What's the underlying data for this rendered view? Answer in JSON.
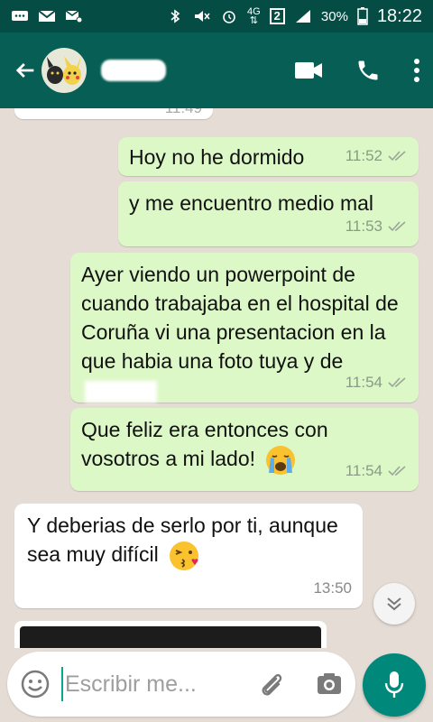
{
  "status_bar": {
    "network": "4G",
    "sim": "2",
    "battery": "30%",
    "time": "18:22"
  },
  "conversation": {
    "partial_top_time": "11:49",
    "messages": [
      {
        "direction": "out",
        "text": "Hoy no he dormido",
        "time": "11:52"
      },
      {
        "direction": "out",
        "text": "y me encuentro medio mal",
        "time": "11:53"
      },
      {
        "direction": "out",
        "text": "Ayer viendo un powerpoint de cuando trabajaba en el hospital de Coruña vi una presentacion en la que habia una foto tuya y de",
        "time": "11:54"
      },
      {
        "direction": "out",
        "text": "Que feliz era entonces con vosotros a mi lado!",
        "time": "11:54",
        "emoji": "crying-face-emoji"
      },
      {
        "direction": "in",
        "text": "Y deberias de serlo por ti, aunque sea muy difícil",
        "time": "13:50",
        "emoji": "kiss-face-emoji"
      }
    ]
  },
  "composer": {
    "placeholder": "Escribir me..."
  },
  "colors": {
    "header": "#075e54",
    "status_bar": "#054d44",
    "outgoing_bubble": "#dcf8c6",
    "incoming_bubble": "#ffffff",
    "mic_button": "#00897b",
    "chat_background": "#e5ddd5"
  }
}
